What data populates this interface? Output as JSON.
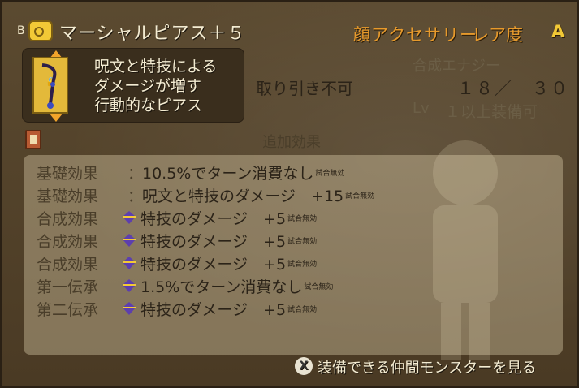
{
  "header": {
    "bag_label": "B",
    "item_name": "マーシャルピアス＋５",
    "slot": "顔アクセサリー",
    "rarity_label": "レア度",
    "rarity_value": "A"
  },
  "description": {
    "lines": [
      "呪文と特技による",
      "ダメージが増す",
      "行動的なピアス"
    ]
  },
  "info": {
    "trade": "取り引き不可",
    "synth_label": "合成エナジー",
    "synth_value": "１８／　３０",
    "lv_label": "Lv",
    "lv_value": "１以上装備可"
  },
  "extra_header": "追加効果",
  "effects": [
    {
      "label": "基礎効果",
      "prefix": "：",
      "text": "10.5%でターン消費なし",
      "badge": "試合無効",
      "gem": false
    },
    {
      "label": "基礎効果",
      "prefix": "：",
      "text": "呪文と特技のダメージ　+15",
      "badge": "試合無効",
      "gem": false
    },
    {
      "label": "合成効果",
      "prefix": "",
      "text": "特技のダメージ　+5",
      "badge": "試合無効",
      "gem": true
    },
    {
      "label": "合成効果",
      "prefix": "",
      "text": "特技のダメージ　+5",
      "badge": "試合無効",
      "gem": true
    },
    {
      "label": "合成効果",
      "prefix": "",
      "text": "特技のダメージ　+5",
      "badge": "試合無効",
      "gem": true
    },
    {
      "label": "第一伝承",
      "prefix": "",
      "text": "1.5%でターン消費なし",
      "badge": "試合無効",
      "gem": true
    },
    {
      "label": "第二伝承",
      "prefix": "",
      "text": "特技のダメージ　+5",
      "badge": "試合無効",
      "gem": true
    }
  ],
  "footer": {
    "button_glyph": "X",
    "text": "装備できる仲間モンスターを見る"
  },
  "colors": {
    "accent_orange": "#e79a2c",
    "gold": "#f2c936",
    "panel_dark": "#3a2e1d"
  }
}
